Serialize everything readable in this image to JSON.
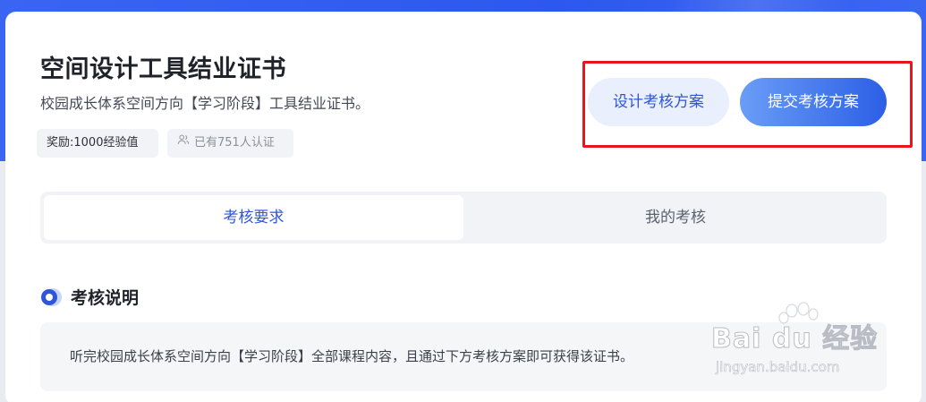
{
  "certificate": {
    "title": "空间设计工具结业证书",
    "subtitle": "校园成长体系空间方向【学习阶段】工具结业证书。",
    "reward_tag": "奖励:1000经验值",
    "certified_count_tag": "已有751人认证"
  },
  "actions": {
    "design_button": "设计考核方案",
    "submit_button": "提交考核方案"
  },
  "tabs": [
    {
      "label": "考核要求",
      "active": true
    },
    {
      "label": "我的考核",
      "active": false
    }
  ],
  "section": {
    "title": "考核说明",
    "description": "听完校园成长体系空间方向【学习阶段】全部课程内容，且通过下方考核方案即可获得该证书。"
  },
  "watermark": {
    "brand": "Bai du 经验",
    "url": "jingyan.baidu.com"
  },
  "colors": {
    "brand_blue": "#2f55d8",
    "header_band": "#3a64f2",
    "highlight_red": "#e8161c"
  }
}
